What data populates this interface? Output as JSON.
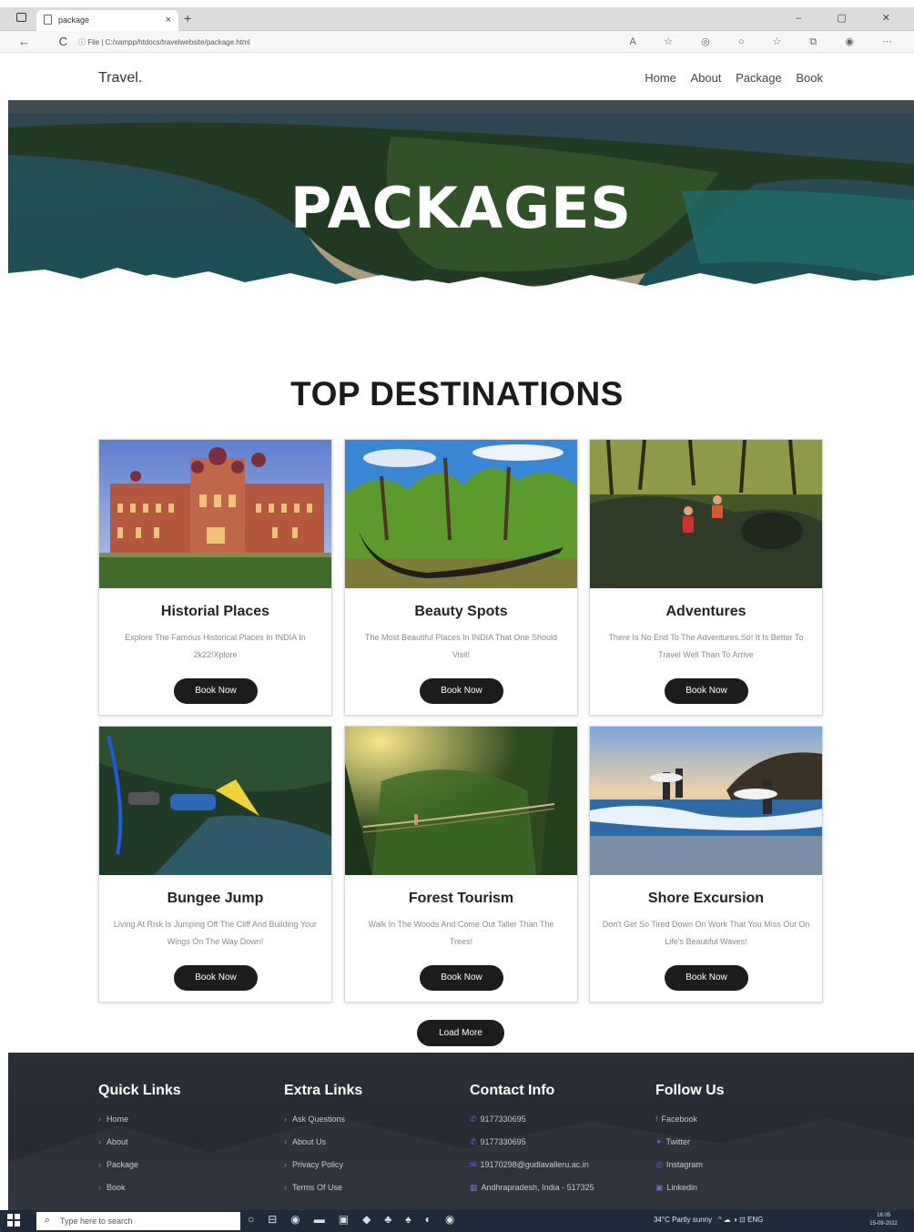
{
  "browser": {
    "tab_title": "package",
    "tab_close": "×",
    "new_tab": "+",
    "window_controls": "–  ▢  ✕",
    "nav_glyphs": "←  C",
    "url_prefix": "ⓘ File  |",
    "url": "C:/xampp/htdocs/travelwebsite/package.html",
    "toolbar_glyphs": "A  ☆  ◎  ○  ☆  ⧉  ◉  ⋯"
  },
  "site": {
    "logo": "Travel.",
    "nav": [
      "Home",
      "About",
      "Package",
      "Book"
    ]
  },
  "hero": {
    "title": "PACKAGES"
  },
  "section": {
    "title": "TOP DESTINATIONS"
  },
  "cards": [
    {
      "title": "Historial Places",
      "text": "Explore The Famous Historical Places In INDIA In 2k22!Xplore",
      "button": "Book Now",
      "image": "palace"
    },
    {
      "title": "Beauty Spots",
      "text": "The Most Beautiful Places In INDIA That One Should Visit!",
      "button": "Book Now",
      "image": "backwaters"
    },
    {
      "title": "Adventures",
      "text": "There Is No End To The Adventures.So! It Is Better To Travel Well Than To Arrive",
      "button": "Book Now",
      "image": "climbers"
    },
    {
      "title": "Bungee Jump",
      "text": "Living At Risk Is Jumping Off The Cliff And Building Your Wings On The Way Down!",
      "button": "Book Now",
      "image": "bungee"
    },
    {
      "title": "Forest Tourism",
      "text": "Walk In The Woods And Come Out Taller Than The Trees!",
      "button": "Book Now",
      "image": "forest"
    },
    {
      "title": "Shore Excursion",
      "text": "Don't Get So Tired Down On Work That You Miss Out On Life's Beautiful Waves!",
      "button": "Book Now",
      "image": "surf"
    }
  ],
  "load_more": "Load More",
  "footer": {
    "quick": {
      "title": "Quick Links",
      "items": [
        "Home",
        "About",
        "Package",
        "Book"
      ]
    },
    "extra": {
      "title": "Extra Links",
      "items": [
        "Ask Questions",
        "About Us",
        "Privacy Policy",
        "Terms Of Use"
      ]
    },
    "contact": {
      "title": "Contact Info",
      "items": [
        "9177330695",
        "9177330695",
        "19170298@gudlavalleru.ac.in",
        "Andhrapradesh, India - 517325"
      ]
    },
    "follow": {
      "title": "Follow Us",
      "items": [
        "Facebook",
        "Twitter",
        "Instagram",
        "Linkedin"
      ]
    }
  },
  "taskbar": {
    "search_placeholder": "Type here to search",
    "weather": "34°C  Partly sunny",
    "tray": "^  ☁  ◑  ⊡  ENG",
    "time": "16:05",
    "date": "15-09-2022"
  },
  "colors": {
    "accent": "#7f5cd0",
    "button": "#1c1c1c",
    "footer": "#2b2f38"
  }
}
